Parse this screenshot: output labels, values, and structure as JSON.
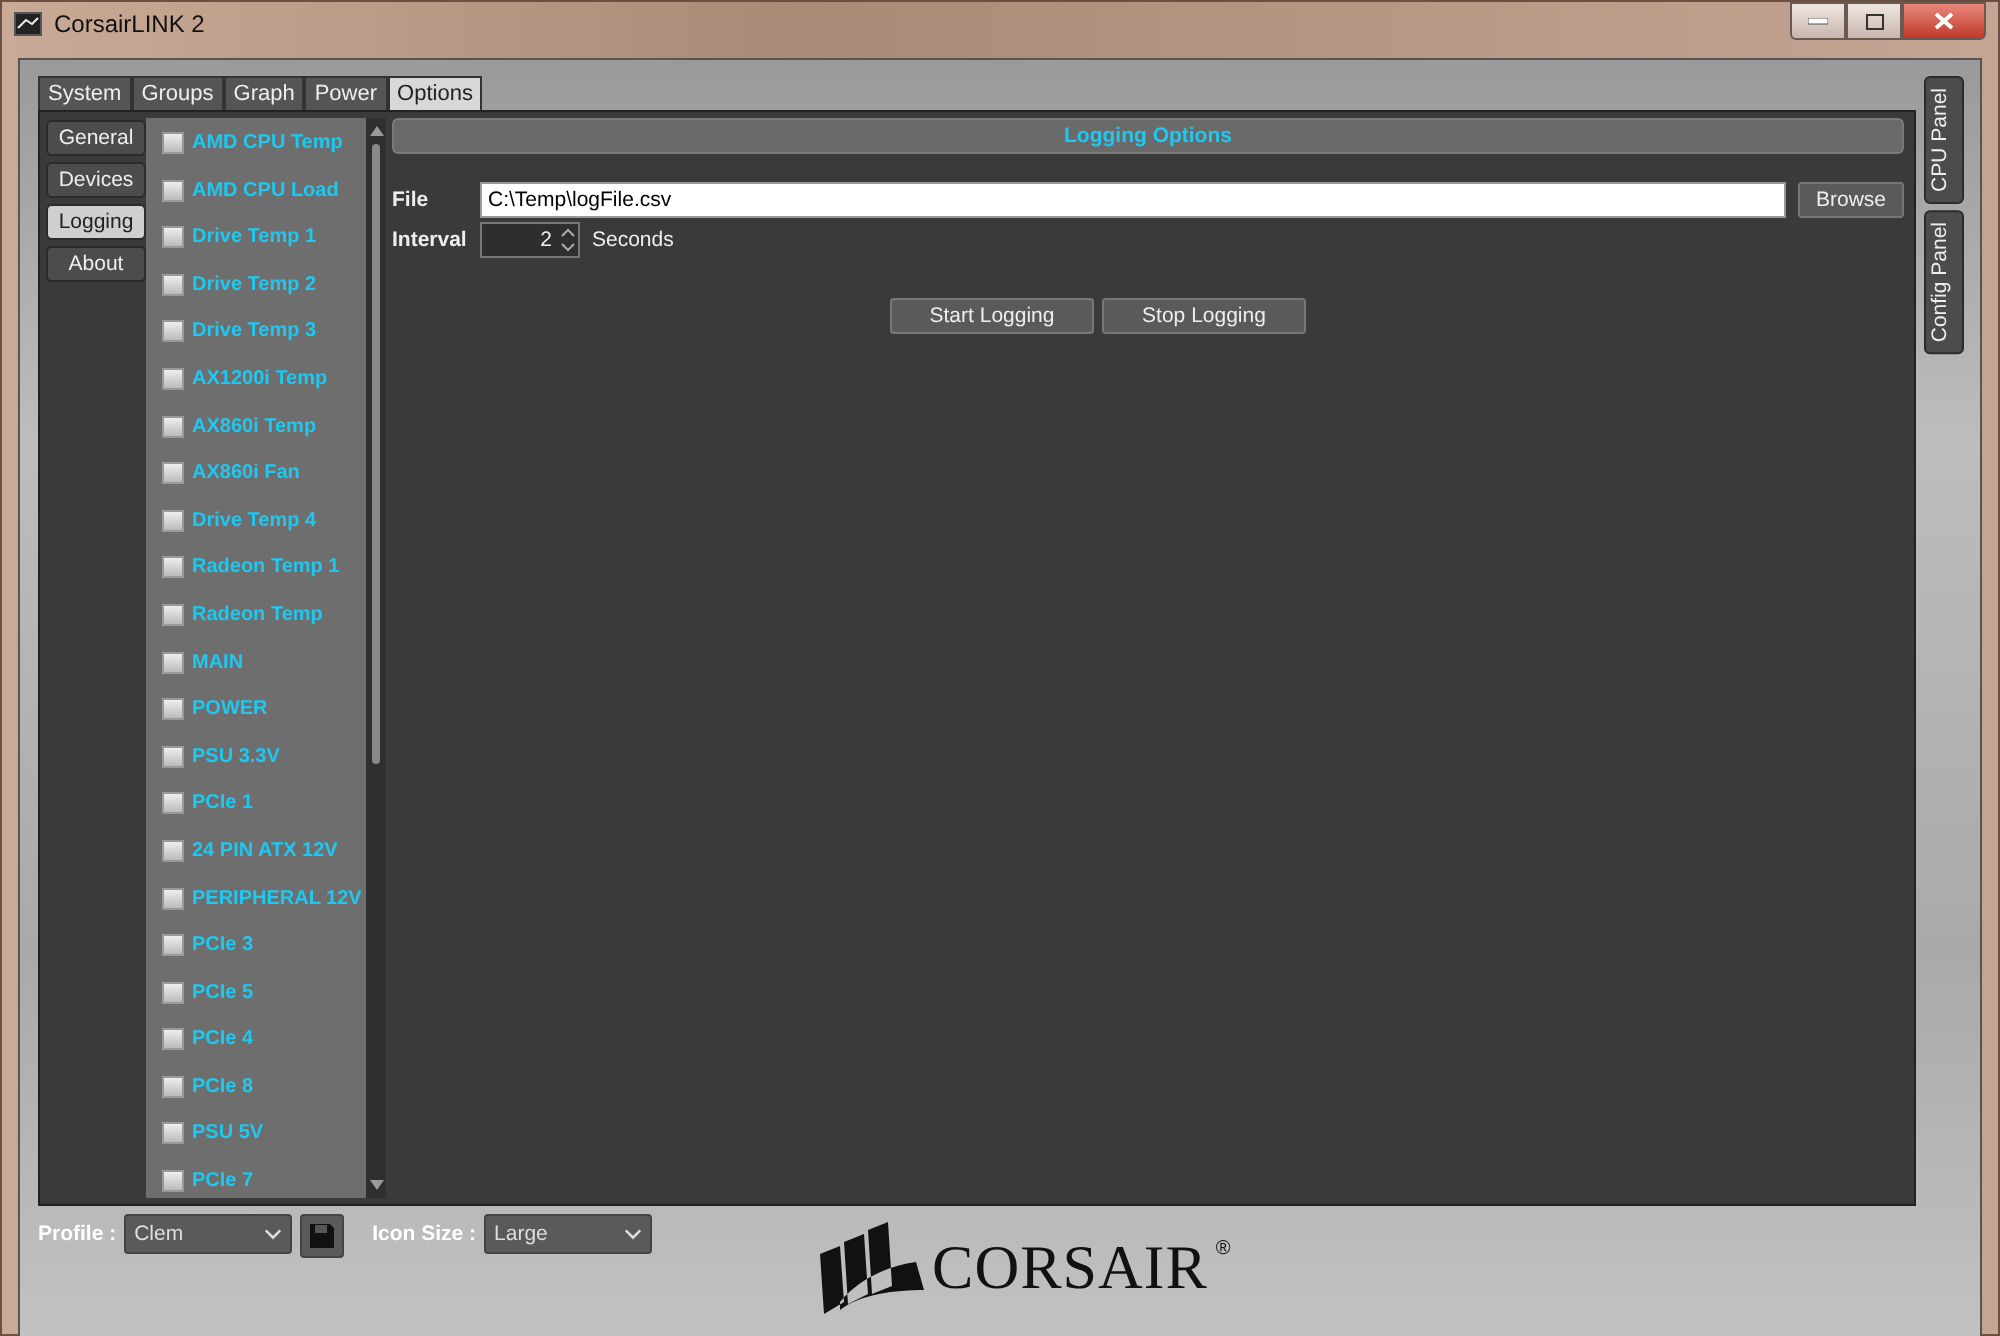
{
  "window": {
    "title": "CorsairLINK 2"
  },
  "tabs": [
    {
      "label": "System",
      "selected": false
    },
    {
      "label": "Groups",
      "selected": false
    },
    {
      "label": "Graph",
      "selected": false
    },
    {
      "label": "Power",
      "selected": false
    },
    {
      "label": "Options",
      "selected": true
    }
  ],
  "side_tabs": [
    {
      "label": "General",
      "selected": false
    },
    {
      "label": "Devices",
      "selected": false
    },
    {
      "label": "Logging",
      "selected": true
    },
    {
      "label": "About",
      "selected": false
    }
  ],
  "sensors": [
    {
      "label": "AMD CPU Temp",
      "checked": false
    },
    {
      "label": "AMD CPU Load",
      "checked": false
    },
    {
      "label": "Drive Temp 1",
      "checked": false
    },
    {
      "label": "Drive Temp 2",
      "checked": false
    },
    {
      "label": "Drive Temp 3",
      "checked": false
    },
    {
      "label": "AX1200i Temp",
      "checked": false
    },
    {
      "label": "AX860i Temp",
      "checked": false
    },
    {
      "label": "AX860i Fan",
      "checked": false
    },
    {
      "label": "Drive Temp 4",
      "checked": false
    },
    {
      "label": "Radeon Temp 1",
      "checked": false
    },
    {
      "label": "Radeon Temp",
      "checked": false
    },
    {
      "label": "MAIN",
      "checked": false
    },
    {
      "label": "POWER",
      "checked": false
    },
    {
      "label": "PSU 3.3V",
      "checked": false
    },
    {
      "label": "PCIe 1",
      "checked": false
    },
    {
      "label": "24 PIN ATX  12V",
      "checked": false
    },
    {
      "label": "PERIPHERAL 12V",
      "checked": false
    },
    {
      "label": "PCIe 3",
      "checked": false
    },
    {
      "label": "PCIe 5",
      "checked": false
    },
    {
      "label": "PCIe 4",
      "checked": false
    },
    {
      "label": "PCIe 8",
      "checked": false
    },
    {
      "label": "PSU 5V",
      "checked": false
    },
    {
      "label": "PCIe 7",
      "checked": false
    }
  ],
  "logging": {
    "title": "Logging Options",
    "file_label": "File",
    "file_value": "C:\\Temp\\logFile.csv",
    "browse": "Browse",
    "interval_label": "Interval",
    "interval_value": "2",
    "interval_unit": "Seconds",
    "buttons": [
      "Start Logging",
      "Stop Logging"
    ]
  },
  "right_tabs": [
    "CPU Panel",
    "Config Panel"
  ],
  "footer": {
    "profile_label": "Profile :",
    "profile_value": "Clem",
    "icon_size_label": "Icon Size :",
    "icon_size_value": "Large",
    "logo_text": "CORSAIR",
    "logo_mark": "®"
  }
}
